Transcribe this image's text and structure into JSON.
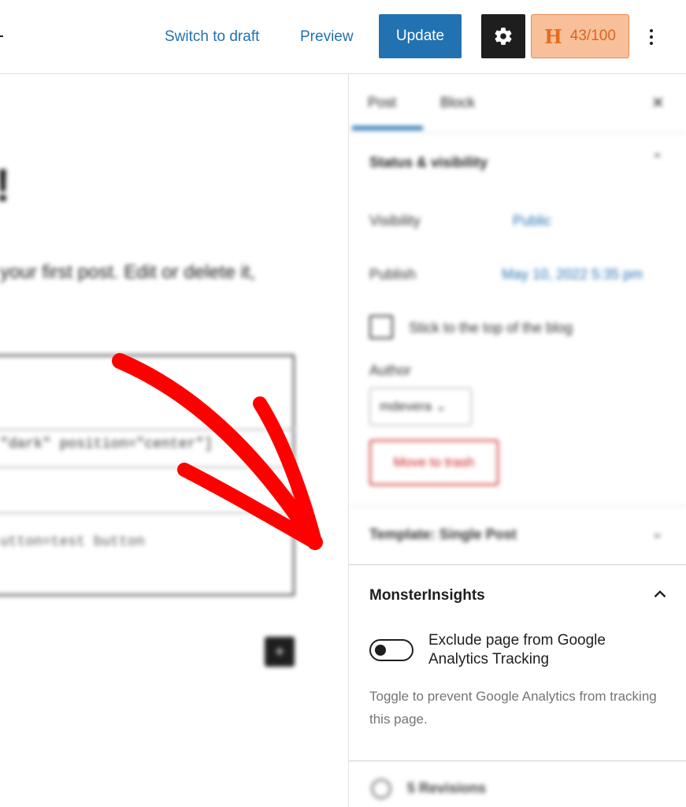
{
  "header": {
    "switch_to_draft": "Switch to draft",
    "preview": "Preview",
    "update": "Update",
    "settings_icon": "gear-icon",
    "score": "43/100",
    "score_letter": "H",
    "more_icon": "more-vertical-icon"
  },
  "editor": {
    "title_fragment": "!",
    "paragraph_fragment": "your first post. Edit or delete it,",
    "code_line_1": "\"dark\" position=\"center\"]",
    "code_line_2": "utton=test button"
  },
  "sidebar": {
    "tabs": [
      {
        "label": "Post"
      },
      {
        "label": "Block"
      }
    ],
    "status_visibility": {
      "title": "Status & visibility",
      "visibility_label": "Visibility",
      "visibility_value": "Public",
      "publish_label": "Publish",
      "publish_value": "May 10, 2022 5:35 pm",
      "sticky_label": "Stick to the top of the blog",
      "author_label": "Author",
      "author_value": "mdevera",
      "trash_label": "Move to trash"
    },
    "template": {
      "title": "Template: Single Post"
    },
    "monsterinsights": {
      "title": "MonsterInsights",
      "toggle_label": "Exclude page from Google Analytics Tracking",
      "toggle_on": false,
      "help_text": "Toggle to prevent Google Analytics from tracking this page."
    },
    "revisions": {
      "label": "5 Revisions"
    }
  },
  "colors": {
    "accent": "#2271b1",
    "score_bg": "#f8c09a",
    "score_text": "#e56c1d",
    "annotation_arrow": "#ff0000",
    "danger": "#cc1818"
  }
}
